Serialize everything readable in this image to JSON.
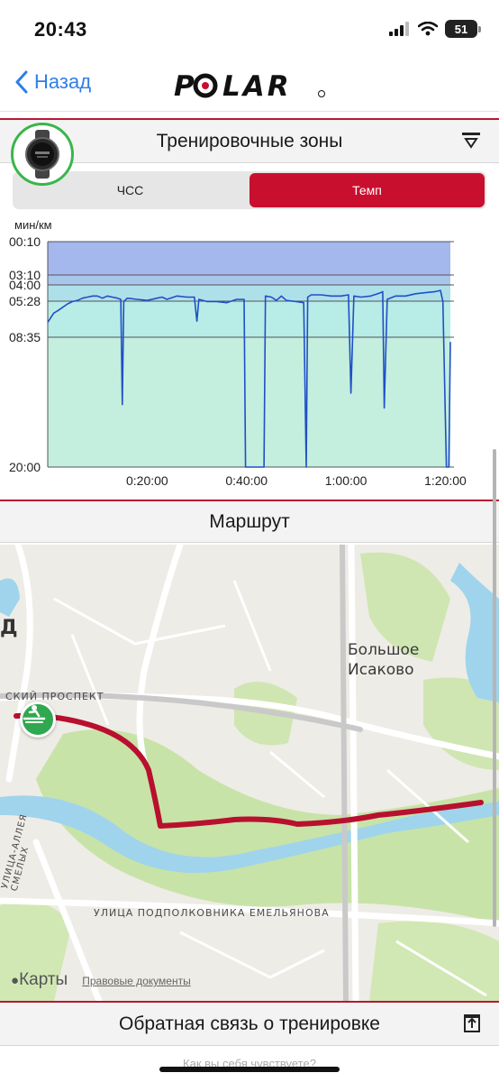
{
  "status_bar": {
    "time": "20:43",
    "battery": "51"
  },
  "nav": {
    "back_label": "Назад",
    "logo_text": "POLAR"
  },
  "zones": {
    "title": "Тренировочные зоны",
    "tabs": [
      {
        "label": "ЧСС",
        "active": false
      },
      {
        "label": "Темп",
        "active": true
      }
    ]
  },
  "chart_data": {
    "type": "line",
    "title": "",
    "xlabel": "",
    "ylabel": "мин/км",
    "y_scale": "pace (reversed, faster at top)",
    "y_ticks": [
      "00:10",
      "03:10",
      "04:00",
      "05:28",
      "08:35",
      "20:00"
    ],
    "x_ticks": [
      "0:20:00",
      "0:40:00",
      "1:00:00",
      "1:20:00"
    ],
    "xlim_minutes": [
      0,
      81
    ],
    "zones": [
      {
        "from": "00:10",
        "to": "03:10",
        "color": "#a4b8ee"
      },
      {
        "from": "03:10",
        "to": "04:00",
        "color": "#a8c6ea"
      },
      {
        "from": "04:00",
        "to": "05:28",
        "color": "#aee0ea"
      },
      {
        "from": "05:28",
        "to": "08:35",
        "color": "#b8ece6"
      },
      {
        "from": "08:35",
        "to": "20:00",
        "color": "#c4eedd"
      }
    ],
    "series": [
      {
        "color": "#1f4fc8",
        "points_min": [
          [
            0,
            7.3
          ],
          [
            0.6,
            6.9
          ],
          [
            1.2,
            6.5
          ],
          [
            2,
            6.3
          ],
          [
            3,
            6.0
          ],
          [
            4,
            5.7
          ],
          [
            5,
            5.5
          ],
          [
            6,
            5.4
          ],
          [
            7,
            5.2
          ],
          [
            8,
            5.1
          ],
          [
            9,
            5.0
          ],
          [
            10,
            5.0
          ],
          [
            11,
            5.2
          ],
          [
            12,
            5.0
          ],
          [
            13,
            5.1
          ],
          [
            14,
            5.2
          ],
          [
            14.7,
            5.3
          ],
          [
            15,
            14.5
          ],
          [
            15.3,
            5.5
          ],
          [
            16,
            5.2
          ],
          [
            18,
            5.3
          ],
          [
            20,
            5.4
          ],
          [
            22,
            5.2
          ],
          [
            23,
            5.1
          ],
          [
            24,
            5.3
          ],
          [
            26,
            5.0
          ],
          [
            28,
            5.1
          ],
          [
            29.5,
            5.1
          ],
          [
            30,
            7.2
          ],
          [
            30.4,
            5.3
          ],
          [
            32,
            5.5
          ],
          [
            34,
            5.5
          ],
          [
            36,
            5.6
          ],
          [
            38,
            5.3
          ],
          [
            39.5,
            5.3
          ],
          [
            39.8,
            20
          ],
          [
            43.5,
            20
          ],
          [
            43.8,
            5.0
          ],
          [
            45,
            5.1
          ],
          [
            46,
            5.4
          ],
          [
            47,
            5.0
          ],
          [
            48,
            5.4
          ],
          [
            50,
            5.5
          ],
          [
            51.5,
            5.6
          ],
          [
            52,
            20
          ],
          [
            52.3,
            5.1
          ],
          [
            53,
            4.9
          ],
          [
            55,
            4.9
          ],
          [
            57,
            5.0
          ],
          [
            59,
            5.0
          ],
          [
            60.5,
            4.9
          ],
          [
            61,
            13.5
          ],
          [
            61.6,
            5.0
          ],
          [
            63,
            5.1
          ],
          [
            65,
            5.0
          ],
          [
            67,
            4.7
          ],
          [
            67.4,
            4.6
          ],
          [
            67.7,
            14.8
          ],
          [
            68.3,
            5.3
          ],
          [
            70,
            5.0
          ],
          [
            72,
            5.0
          ],
          [
            74,
            4.8
          ],
          [
            76,
            4.7
          ],
          [
            78,
            4.6
          ],
          [
            79,
            4.5
          ],
          [
            79.5,
            5.5
          ],
          [
            80.2,
            20
          ],
          [
            80.7,
            20
          ],
          [
            81,
            9.0
          ]
        ]
      }
    ],
    "grid": true
  },
  "route": {
    "title": "Маршрут",
    "map_labels": {
      "place": "Большое Исаково",
      "street_prospect": "СКИЙ ПРОСПЕКТ",
      "street_emelyanova": "УЛИЦА ПОДПОЛКОВНИКА ЕМЕЛЬЯНОВА",
      "street_alley": "УЛИЦА-АЛЛЕЯ СМЕЛЫХ",
      "edge_letter": "Д"
    },
    "maps_brand": "Карты",
    "legal_link": "Правовые документы",
    "route_color": "#b8102e"
  },
  "feedback": {
    "title": "Обратная связь о тренировке"
  },
  "footer_hint": "Как вы себя чувствуете?"
}
